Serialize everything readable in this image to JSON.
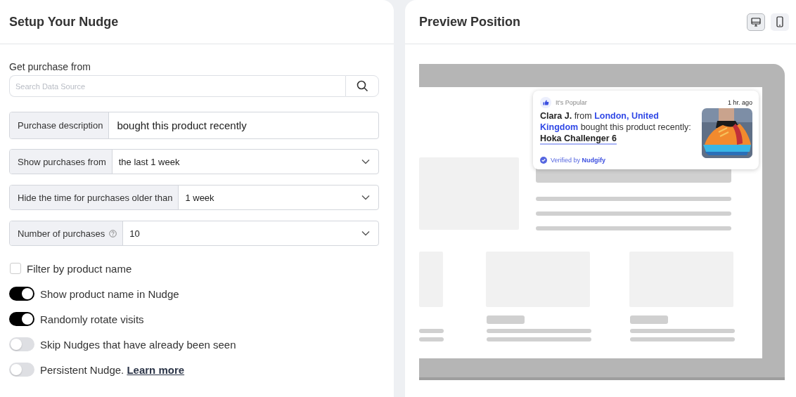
{
  "setup": {
    "title": "Setup Your Nudge",
    "source": {
      "label": "Get purchase from",
      "placeholder": "Search Data Source"
    },
    "fields": [
      {
        "kind": "text",
        "label": "Purchase description",
        "value": "bought this product recently"
      },
      {
        "kind": "select",
        "label": "Show purchases from",
        "value": "the last 1 week"
      },
      {
        "kind": "select",
        "label": "Hide the time for purchases older than",
        "value": "1 week"
      },
      {
        "kind": "select",
        "label": "Number of purchases",
        "help": true,
        "value": "10"
      }
    ],
    "options": [
      {
        "kind": "checkbox",
        "label": "Filter by product name",
        "checked": false
      },
      {
        "kind": "toggle",
        "label": "Show product name in Nudge",
        "checked": true
      },
      {
        "kind": "toggle",
        "label": "Randomly rotate visits",
        "checked": true
      },
      {
        "kind": "toggle",
        "label": "Skip Nudges that have already been seen",
        "checked": false
      },
      {
        "kind": "toggle",
        "label": "Persistent Nudge.",
        "link": "Learn more",
        "checked": false
      }
    ]
  },
  "preview": {
    "title": "Preview Position",
    "devices": [
      {
        "kind": "desktop",
        "selected": true
      },
      {
        "kind": "mobile",
        "selected": false
      }
    ],
    "nudge": {
      "badge": "It's Popular",
      "time": "1 hr. ago",
      "name": "Clara J.",
      "connector": "from",
      "location": "London, United Kingdom",
      "action": "bought this product recently:",
      "product": "Hoka Challenger 6",
      "verified": "Verified by",
      "brand": "Nudgify"
    }
  }
}
